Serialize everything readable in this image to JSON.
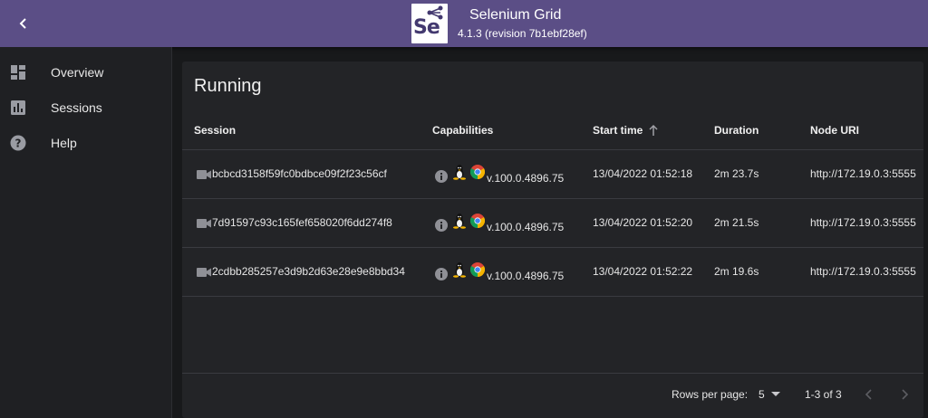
{
  "header": {
    "title": "Selenium Grid",
    "version": "4.1.3 (revision 7b1ebf28ef)",
    "logo_text": "Se",
    "accent_color": "#5b4e86"
  },
  "sidebar": {
    "items": [
      {
        "label": "Overview",
        "icon": "dashboard-icon"
      },
      {
        "label": "Sessions",
        "icon": "assessment-icon"
      },
      {
        "label": "Help",
        "icon": "help-icon"
      }
    ]
  },
  "main": {
    "title": "Running",
    "columns": [
      "Session",
      "Capabilities",
      "Start time",
      "Duration",
      "Node URI"
    ],
    "sorted_column": "Start time",
    "sort_direction": "ascending",
    "rows": [
      {
        "session": "bcbcd3158f59fc0bdbce09f2f23c56cf",
        "browser_version": "v.100.0.4896.75",
        "start_time": "13/04/2022 01:52:18",
        "duration": "2m 23.7s",
        "node_uri": "http://172.19.0.3:5555"
      },
      {
        "session": "7d91597c93c165fef658020f6dd274f8",
        "browser_version": "v.100.0.4896.75",
        "start_time": "13/04/2022 01:52:20",
        "duration": "2m 21.5s",
        "node_uri": "http://172.19.0.3:5555"
      },
      {
        "session": "2cdbb285257e3d9b2d63e28e9e8bbd34",
        "browser_version": "v.100.0.4896.75",
        "start_time": "13/04/2022 01:52:22",
        "duration": "2m 19.6s",
        "node_uri": "http://172.19.0.3:5555"
      }
    ]
  },
  "footer": {
    "rows_per_page_label": "Rows per page:",
    "rows_per_page_value": "5",
    "range": "1-3 of 3"
  }
}
